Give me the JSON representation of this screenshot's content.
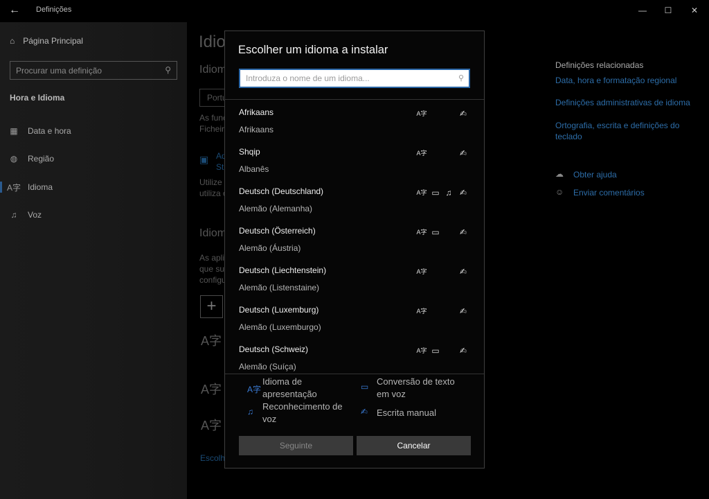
{
  "window": {
    "title": "Definições",
    "back_icon": "←",
    "min_icon": "—",
    "max_icon": "☐",
    "close_icon": "✕"
  },
  "nav": {
    "home_label": "Página Principal",
    "search_placeholder": "Procurar uma definição",
    "section": "Hora e Idioma",
    "items": [
      {
        "label": "Data e hora",
        "icon": "calendar-icon"
      },
      {
        "label": "Região",
        "icon": "globe-icon"
      },
      {
        "label": "Idioma",
        "icon": "language-icon"
      },
      {
        "label": "Voz",
        "icon": "microphone-icon"
      }
    ]
  },
  "background": {
    "title": "Idio",
    "subtitle1": "Idiom",
    "dropdown_value": "Portu",
    "text1a": "As func",
    "text1b": "Ficheiro",
    "link1a": "Ad",
    "link1b": "St",
    "text2a": "Utilize",
    "text2b": "utiliza o",
    "subtitle2": "Idiom",
    "text3a": "As aplic",
    "text3b": "que sup",
    "text3c": "configu",
    "plus": "+",
    "glyph": "A字",
    "bottom_link": "Escolhe",
    "related_title": "Definições relacionadas",
    "related_links": [
      "Data, hora e formatação regional",
      "Definições administrativas de idioma",
      "Ortografia, escrita e definições do teclado"
    ],
    "help_label": "Obter ajuda",
    "feedback_label": "Enviar comentários"
  },
  "modal": {
    "title": "Escolher um idioma a instalar",
    "search_placeholder": "Introduza o nome de um idioma...",
    "languages": [
      {
        "native": "Afrikaans",
        "portuguese": "Afrikaans",
        "features": {
          "display": true,
          "tts": false,
          "speech": false,
          "handwriting": true
        }
      },
      {
        "native": "Shqip",
        "portuguese": "Albanês",
        "features": {
          "display": true,
          "tts": false,
          "speech": false,
          "handwriting": true
        }
      },
      {
        "native": "Deutsch (Deutschland)",
        "portuguese": "Alemão (Alemanha)",
        "features": {
          "display": true,
          "tts": true,
          "speech": true,
          "handwriting": true
        }
      },
      {
        "native": "Deutsch (Österreich)",
        "portuguese": "Alemão (Áustria)",
        "features": {
          "display": true,
          "tts": true,
          "speech": false,
          "handwriting": true
        }
      },
      {
        "native": "Deutsch (Liechtenstein)",
        "portuguese": "Alemão (Listenstaine)",
        "features": {
          "display": true,
          "tts": false,
          "speech": false,
          "handwriting": true
        }
      },
      {
        "native": "Deutsch (Luxemburg)",
        "portuguese": "Alemão (Luxemburgo)",
        "features": {
          "display": true,
          "tts": false,
          "speech": false,
          "handwriting": true
        }
      },
      {
        "native": "Deutsch (Schweiz)",
        "portuguese": "Alemão (Suíça)",
        "features": {
          "display": true,
          "tts": true,
          "speech": false,
          "handwriting": true
        }
      }
    ],
    "legend": {
      "display_line1": "Idioma de",
      "display_line2": "apresentação",
      "tts_line1": "Conversão de texto",
      "tts_line2": "em voz",
      "speech_line1": "Reconhecimento de",
      "speech_line2": "voz",
      "handwriting": "Escrita manual"
    },
    "buttons": {
      "next": "Seguinte",
      "cancel": "Cancelar"
    },
    "colors": {
      "accent": "#3a7bd5",
      "focus_border": "#2a66a6"
    }
  }
}
